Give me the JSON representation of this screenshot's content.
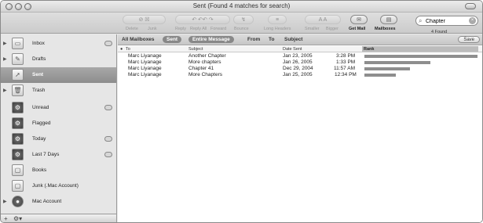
{
  "window": {
    "title": "Sent (Found 4 matches for search)"
  },
  "toolbar": {
    "buttons": [
      {
        "label": "Delete",
        "icon": "delete-icon"
      },
      {
        "label": "Junk",
        "icon": "junk-icon"
      },
      {
        "label": "Reply",
        "icon": "reply-icon"
      },
      {
        "label": "Reply All",
        "icon": "reply-all-icon"
      },
      {
        "label": "Forward",
        "icon": "forward-icon"
      },
      {
        "label": "Bounce",
        "icon": "bounce-icon"
      },
      {
        "label": "Long Headers",
        "icon": "headers-icon"
      },
      {
        "label": "Smaller",
        "icon": "smaller-icon"
      },
      {
        "label": "Bigger",
        "icon": "bigger-icon"
      },
      {
        "label": "Get Mail",
        "icon": "get-mail-icon"
      },
      {
        "label": "Mailboxes",
        "icon": "mailboxes-icon"
      }
    ],
    "search_value": "Chapter",
    "found_text": "4 Found"
  },
  "sidebar": {
    "mailboxes": [
      {
        "label": "Inbox",
        "icon": "inbox-icon"
      },
      {
        "label": "Drafts",
        "icon": "drafts-icon"
      },
      {
        "label": "Sent",
        "icon": "sent-icon"
      },
      {
        "label": "Trash",
        "icon": "trash-icon"
      },
      {
        "label": "Unread",
        "icon": "unread-smart-folder-icon"
      },
      {
        "label": "Flagged",
        "icon": "flagged-smart-folder-icon"
      },
      {
        "label": "Today",
        "icon": "today-smart-folder-icon"
      },
      {
        "label": "Last 7 Days",
        "icon": "last-7-days-smart-folder-icon"
      },
      {
        "label": "Books",
        "icon": "folder-icon"
      },
      {
        "label": "Junk (.Mac Account)",
        "icon": "junk-folder-icon"
      },
      {
        "label": "Mac Account",
        "icon": "mac-account-icon"
      }
    ],
    "selected": "Sent"
  },
  "scope": {
    "items": [
      "All Mailboxes",
      "Sent",
      "Entire Message",
      "From",
      "To",
      "Subject"
    ],
    "selected": [
      "Sent",
      "Entire Message"
    ],
    "save_label": "Save"
  },
  "columns": [
    "To",
    "Subject",
    "Date Sent",
    "Rank"
  ],
  "messages": [
    {
      "to": "Marc Liyanage",
      "subject": "Another Chapter",
      "date": "Jan 23, 2005",
      "time": "3:28 PM",
      "rank": 1.0
    },
    {
      "to": "Marc Liyanage",
      "subject": "More chapters",
      "date": "Jan 26, 2005",
      "time": "1:33 PM",
      "rank": 0.58
    },
    {
      "to": "Marc Liyanage",
      "subject": "Chapter 41",
      "date": "Dec 29, 2004",
      "time": "11:57 AM",
      "rank": 0.4
    },
    {
      "to": "Marc Liyanage",
      "subject": "More Chapters",
      "date": "Jan 25, 2005",
      "time": "12:34 PM",
      "rank": 0.28
    }
  ],
  "colors": {
    "rank_bar": "#8e8e8e",
    "selected_mailbox": "#9a9a9a"
  }
}
